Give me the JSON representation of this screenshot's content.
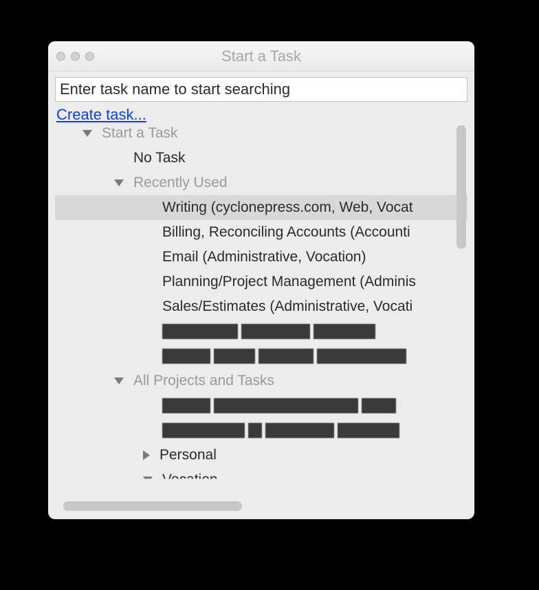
{
  "window": {
    "title": "Start a Task"
  },
  "search": {
    "placeholder": "Enter task name to start searching",
    "value": ""
  },
  "create_task_label": "Create task...",
  "tree": {
    "root_label": "Start a Task",
    "no_task_label": "No Task",
    "recently_used_label": "Recently Used",
    "recent_items": [
      "Writing (cyclonepress.com, Web, Vocat",
      "Billing, Reconciling Accounts (Accounti",
      "Email (Administrative, Vocation)",
      "Planning/Project Management (Adminis",
      "Sales/Estimates (Administrative, Vocati"
    ],
    "all_projects_label": "All Projects and Tasks",
    "personal_label": "Personal",
    "vocation_label": "Vocation"
  }
}
